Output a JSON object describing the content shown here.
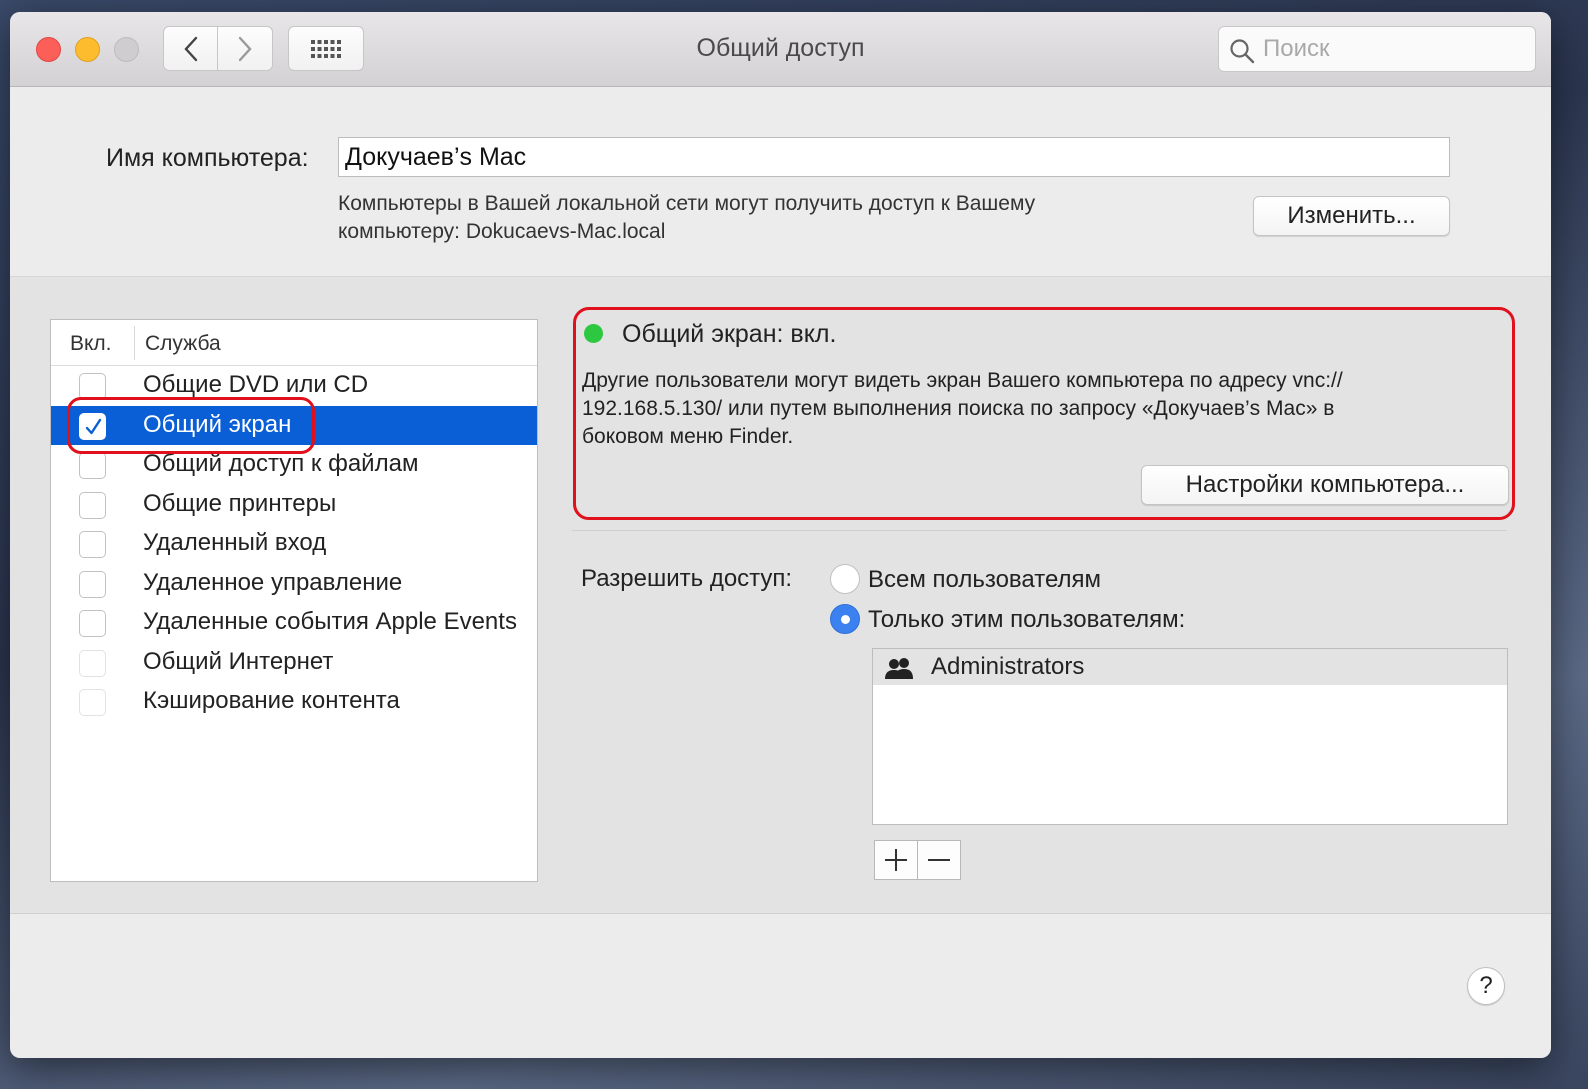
{
  "window": {
    "title": "Общий доступ",
    "search_placeholder": "Поиск"
  },
  "computer_name": {
    "label": "Имя компьютера:",
    "value": "Докучаев’s Mac",
    "description_line1": "Компьютеры в Вашей локальной сети могут получить доступ к Вашему",
    "description_line2": "компьютеру: Dokucaevs-Mac.local",
    "change_button": "Изменить..."
  },
  "services": {
    "col_on": "Вкл.",
    "col_service": "Служба",
    "items": [
      {
        "label": "Общие DVD или CD",
        "checked": false
      },
      {
        "label": "Общий экран",
        "checked": true,
        "selected": true
      },
      {
        "label": "Общий доступ к файлам",
        "checked": false
      },
      {
        "label": "Общие принтеры",
        "checked": false
      },
      {
        "label": "Удаленный вход",
        "checked": false
      },
      {
        "label": "Удаленное управление",
        "checked": false
      },
      {
        "label": "Удаленные события Apple Events",
        "checked": false
      },
      {
        "label": "Общий Интернет",
        "checked": false
      },
      {
        "label": "Кэширование контента",
        "checked": false
      }
    ]
  },
  "status": {
    "title": "Общий экран: вкл.",
    "status_color": "#2ec840",
    "description_line1": "Другие пользователи могут видеть экран Вашего компьютера по адресу vnc://",
    "description_line2": "192.168.5.130/ или путем выполнения поиска по запросу «Докучаев’s Mac» в",
    "description_line3": "боковом меню Finder.",
    "settings_button": "Настройки компьютера..."
  },
  "access": {
    "label": "Разрешить доступ:",
    "option_all": "Всем пользователям",
    "option_only": "Только этим пользователям:",
    "selected": "only",
    "users": [
      "Administrators"
    ]
  },
  "colors": {
    "selection": "#0a5fd6",
    "highlight_ring": "#e0101c",
    "radio_on": "#3b82f0"
  }
}
